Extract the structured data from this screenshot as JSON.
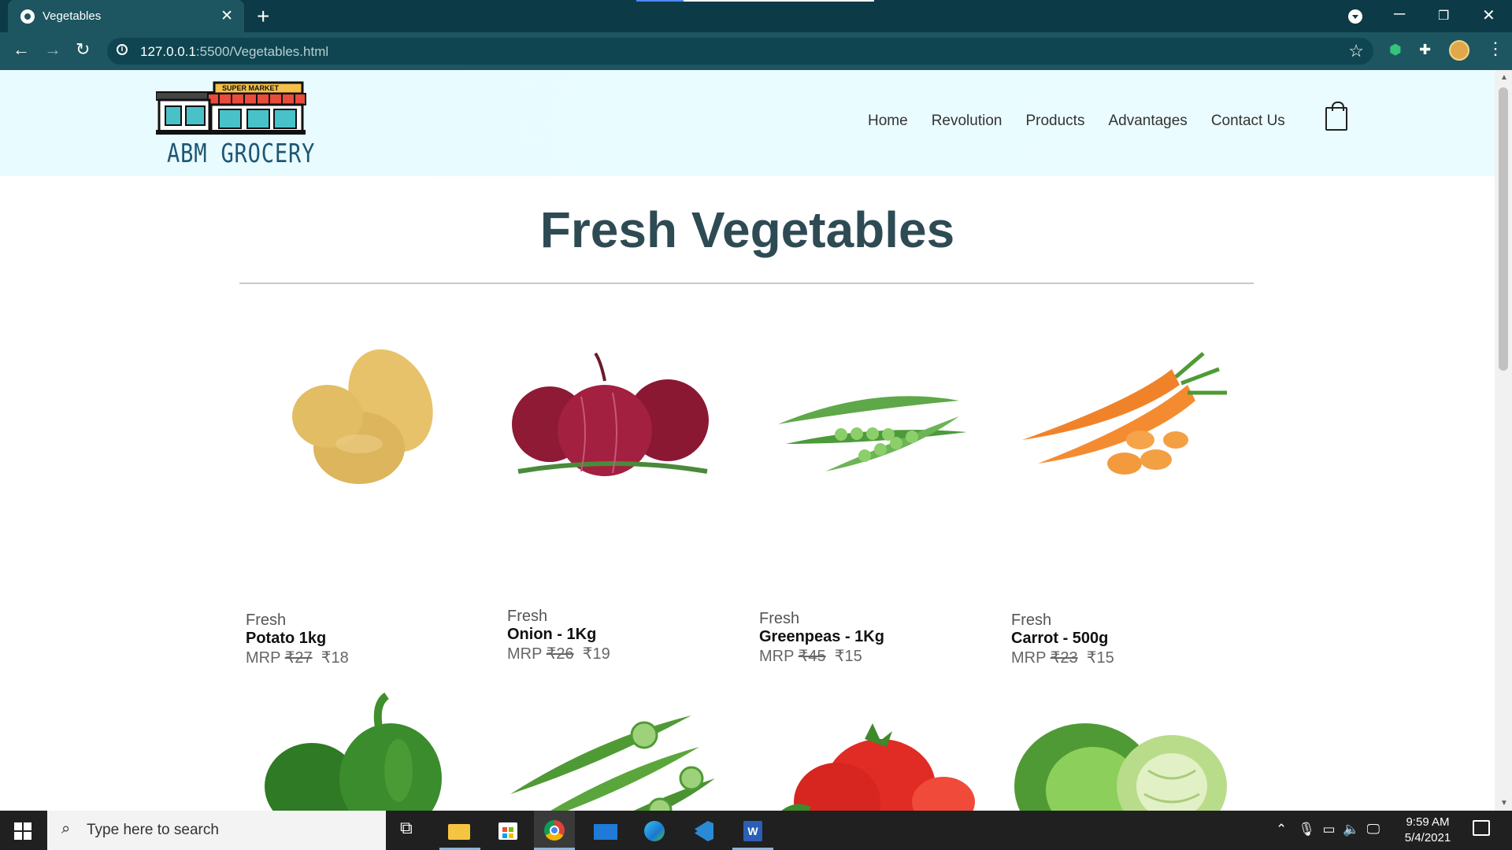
{
  "browser": {
    "tab_title": "Vegetables",
    "tab_close": "✕",
    "new_tab": "+",
    "url_host": "127.0.0.1",
    "url_path": ":5500/Vegetables.html"
  },
  "site": {
    "logo_text": "ABM GROCERY",
    "logo_sign": "SUPER MARKET",
    "nav": [
      "Home",
      "Revolution",
      "Products",
      "Advantages",
      "Contact Us"
    ],
    "page_title": "Fresh Vegetables"
  },
  "products": [
    {
      "fresh": "Fresh",
      "name": "Potato 1kg",
      "mrp_label": "MRP",
      "mrp": "₹27",
      "price": "₹18",
      "image": "potato"
    },
    {
      "fresh": "Fresh",
      "name": "Onion - 1Kg",
      "mrp_label": "MRP",
      "mrp": "₹26",
      "price": "₹19",
      "image": "red-onion"
    },
    {
      "fresh": "Fresh",
      "name": "Greenpeas - 1Kg",
      "mrp_label": "MRP",
      "mrp": "₹45",
      "price": "₹15",
      "image": "green-peas"
    },
    {
      "fresh": "Fresh",
      "name": "Carrot - 500g",
      "mrp_label": "MRP",
      "mrp": "₹23",
      "price": "₹15",
      "image": "carrot"
    }
  ],
  "second_row_images": [
    "green-capsicum",
    "okra",
    "tomato",
    "cabbage"
  ],
  "taskbar": {
    "search_placeholder": "Type here to search",
    "time": "9:59 AM",
    "date": "5/4/2021"
  },
  "colors": {
    "title_bar": "#0c3a46",
    "toolbar": "#1d5660",
    "header_bg": "#e8fbff",
    "title_text": "#2e4b54"
  }
}
